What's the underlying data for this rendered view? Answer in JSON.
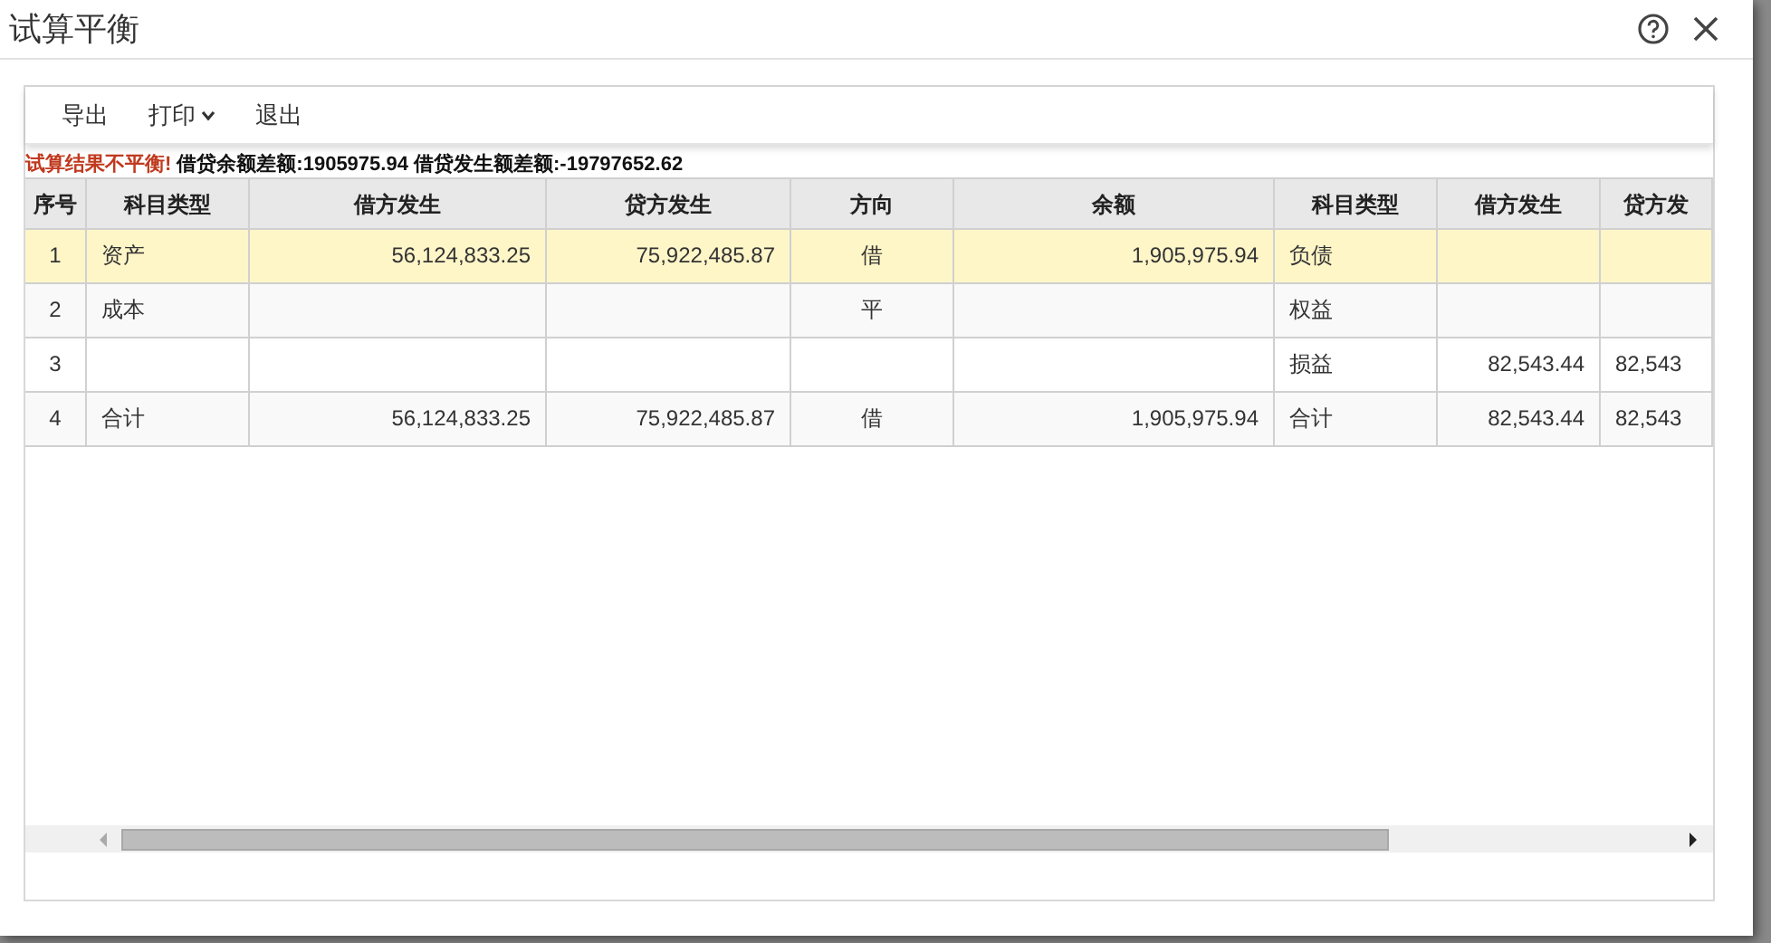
{
  "window": {
    "title": "试算平衡"
  },
  "toolbar": [
    {
      "label": "导出",
      "kind": "button"
    },
    {
      "label": "打印",
      "kind": "dropdown"
    },
    {
      "label": "退出",
      "kind": "button"
    }
  ],
  "message": {
    "warning": "试算结果不平衡!",
    "detail": "借贷余额差额:1905975.94 借贷发生额差额:-19797652.62"
  },
  "table": {
    "columns": [
      "序号",
      "科目类型",
      "借方发生",
      "贷方发生",
      "方向",
      "余额",
      "科目类型",
      "借方发生",
      "贷方发"
    ],
    "rows": [
      {
        "selected": true,
        "cells": [
          "1",
          "资产",
          "56,124,833.25",
          "75,922,485.87",
          "借",
          "1,905,975.94",
          "负债",
          "",
          ""
        ]
      },
      {
        "selected": false,
        "cells": [
          "2",
          "成本",
          "",
          "",
          "平",
          "",
          "权益",
          "",
          ""
        ]
      },
      {
        "selected": false,
        "cells": [
          "3",
          "",
          "",
          "",
          "",
          "",
          "损益",
          "82,543.44",
          "82,543"
        ]
      },
      {
        "selected": false,
        "cells": [
          "4",
          "合计",
          "56,124,833.25",
          "75,922,485.87",
          "借",
          "1,905,975.94",
          "合计",
          "82,543.44",
          "82,543"
        ]
      }
    ]
  }
}
